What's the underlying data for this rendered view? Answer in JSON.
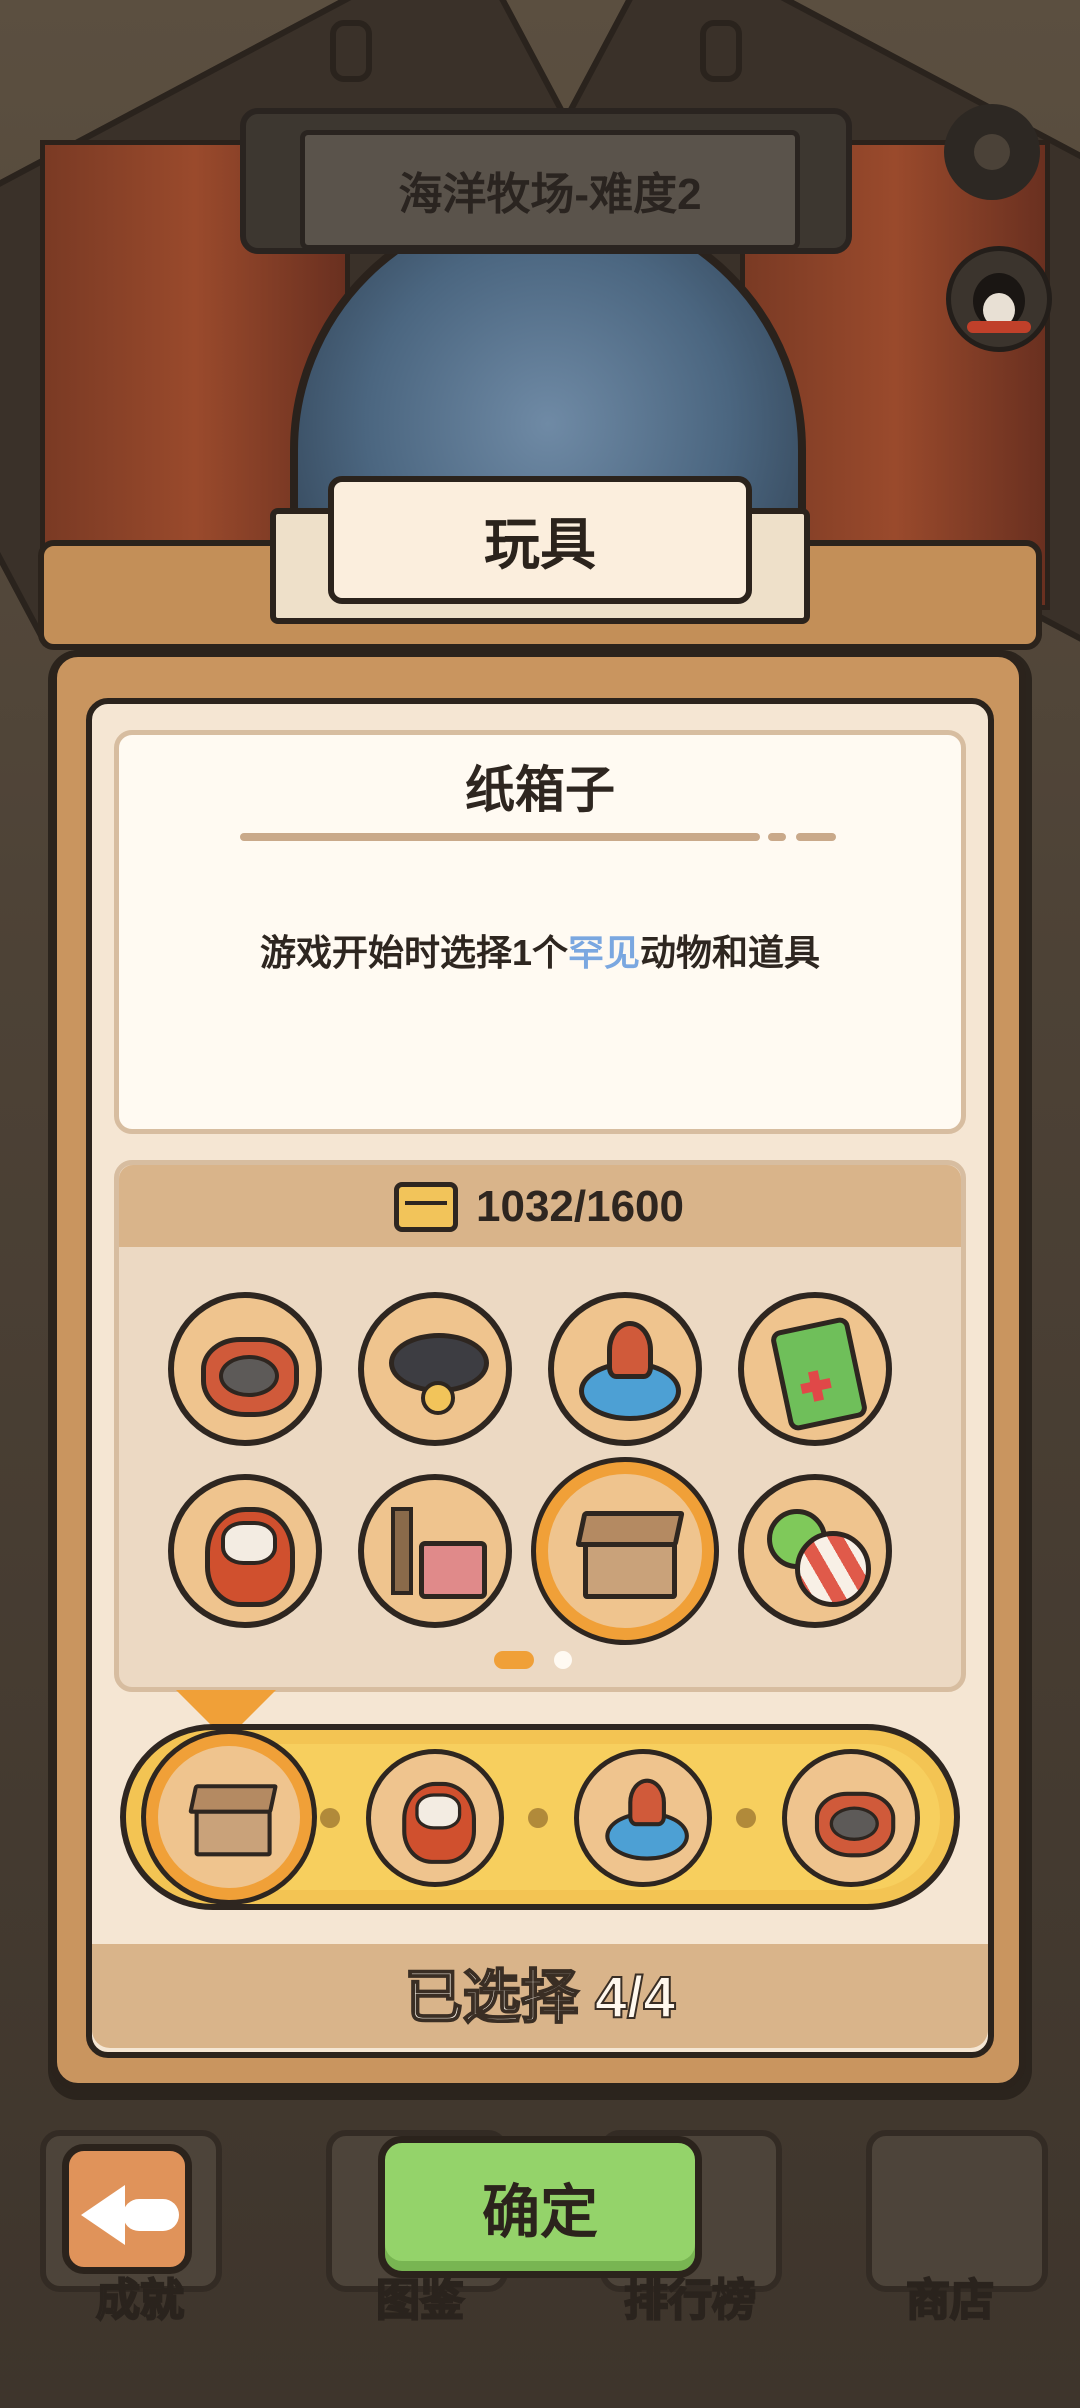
{
  "level": {
    "title": "海洋牧场-难度2"
  },
  "panel": {
    "title": "玩具"
  },
  "item": {
    "name": "纸箱子",
    "description_before": "游戏开始时选择1个",
    "description_highlight": "罕见",
    "description_after": "动物和道具"
  },
  "inventory": {
    "count": "1032/1600"
  },
  "toys": [
    {
      "name": "bowl-icon"
    },
    {
      "name": "collar-icon"
    },
    {
      "name": "spinner-toy-icon"
    },
    {
      "name": "game-console-icon"
    },
    {
      "name": "cat-doll-icon"
    },
    {
      "name": "cat-tree-icon"
    },
    {
      "name": "cardboard-box-icon",
      "selected": true
    },
    {
      "name": "balls-icon"
    }
  ],
  "pagination": {
    "pages": 2,
    "current": 1
  },
  "selected_slots": [
    "cardboard-box-icon",
    "cat-doll-icon",
    "spinner-toy-icon",
    "bowl-icon"
  ],
  "selection": {
    "label": "已选择 4/4"
  },
  "buttons": {
    "confirm": "确定"
  },
  "nav": {
    "achievements": "成就",
    "collection": "图鉴",
    "leaderboard": "排行榜",
    "shop": "商店"
  },
  "colors": {
    "accent": "#f0a038",
    "confirm": "#94d36a",
    "highlight": "#7aa7e0"
  }
}
